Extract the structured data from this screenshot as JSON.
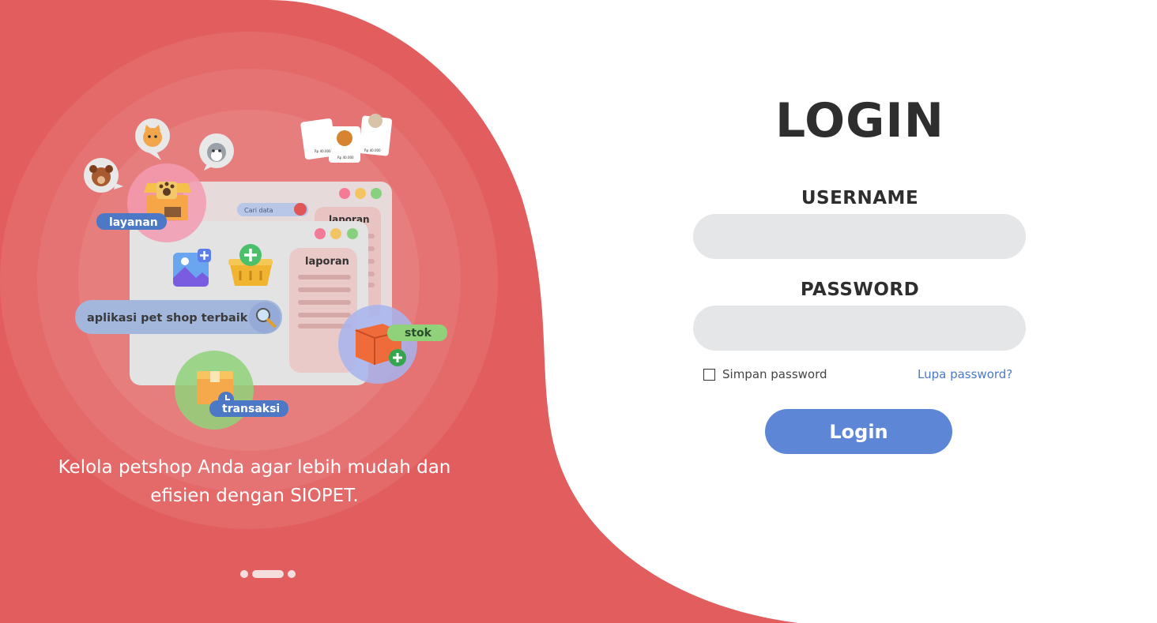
{
  "illustration": {
    "chips": {
      "layanan": "layanan",
      "transaksi": "transaksi",
      "stok": "stok"
    },
    "search_bar_text": "aplikasi pet shop terbaik",
    "mini_search_placeholder": "Cari data",
    "report_title": "laporan",
    "report_title_back": "laporan",
    "cards": {
      "price_1": "Rp 40.000",
      "price_2": "Rp 40.000",
      "price_3": "Rp 40.000"
    }
  },
  "tagline": {
    "line1": "Kelola petshop Anda agar lebih mudah dan",
    "line2": "efisien dengan SIOPET."
  },
  "carousel": {
    "active_index": 1,
    "count": 3
  },
  "login": {
    "title": "LOGIN",
    "username_label": "USERNAME",
    "username_value": "",
    "password_label": "PASSWORD",
    "password_value": "",
    "remember_label": "Simpan password",
    "remember_checked": false,
    "forgot_label": "Lupa password?",
    "submit_label": "Login"
  },
  "colors": {
    "brand_red": "#e25e5e",
    "accent_blue": "#5d86d6",
    "input_bg": "#e5e6e8",
    "link_blue": "#4b79c9"
  }
}
